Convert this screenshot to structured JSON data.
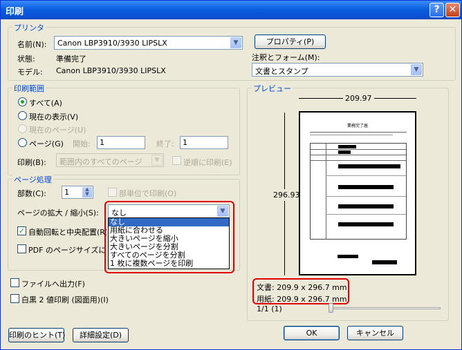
{
  "window": {
    "title": "印刷",
    "help_glyph": "?",
    "close_glyph": "✕"
  },
  "printer": {
    "legend": "プリンタ",
    "name_label": "名前(N):",
    "name_value": "Canon LBP3910/3930 LIPSLX",
    "properties_button": "プロパティ(P)",
    "status_label": "状態:",
    "status_value": "準備完了",
    "model_label": "モデル:",
    "model_value": "Canon LBP3910/3930 LIPSLX",
    "annotations_label": "注釈とフォーム(M):",
    "annotations_value": "文書とスタンプ"
  },
  "range": {
    "legend": "印刷範囲",
    "all": "すべて(A)",
    "current_view": "現在の表示(V)",
    "current_page": "現在のページ(U)",
    "pages": "ページ(G)",
    "start_label": "開始:",
    "start_value": "1",
    "end_label": "終了:",
    "end_value": "1",
    "print_label": "印刷(B):",
    "print_value": "範囲内のすべてのページ",
    "reverse_label": "逆順に印刷(E)"
  },
  "handling": {
    "legend": "ページ処理",
    "copies_label": "部数(C):",
    "copies_value": "1",
    "collate_label": "部単位で印刷(O)",
    "zoom_label": "ページの拡大 / 縮小(S):",
    "zoom_value": "なし",
    "zoom_options": [
      "なし",
      "用紙に合わせる",
      "大きいページを縮小",
      "大きいページを分割",
      "すべてのページを分割",
      "1 枚に複数ページを印刷"
    ],
    "auto_rotate_label": "自動回転と中央配置(R)",
    "pdf_size_label": "PDF のページサイズに合わせて用紙を選択(Z)"
  },
  "print_to_file": "ファイルへ出力(F)",
  "grayscale": "白黒 2 値印刷 (図面用)(I)",
  "preview": {
    "legend": "プレビュー",
    "width_value": "209.97",
    "height_value": "296.93",
    "doc_text": "文書:  209.9 x 296.7 mm",
    "paper_text": "用紙:  209.9 x 296.7 mm",
    "page_counter": "1/1  (1)",
    "doc_heading": "業務完了届"
  },
  "buttons": {
    "tips": "印刷のヒント(T)",
    "advanced": "詳細設定(D)",
    "ok": "OK",
    "cancel": "キャンセル"
  },
  "colors": {
    "title_blue": "#0a5fe0",
    "legend_blue": "#0046d5",
    "highlight_red": "#e00000",
    "selection_blue": "#316ac5"
  }
}
